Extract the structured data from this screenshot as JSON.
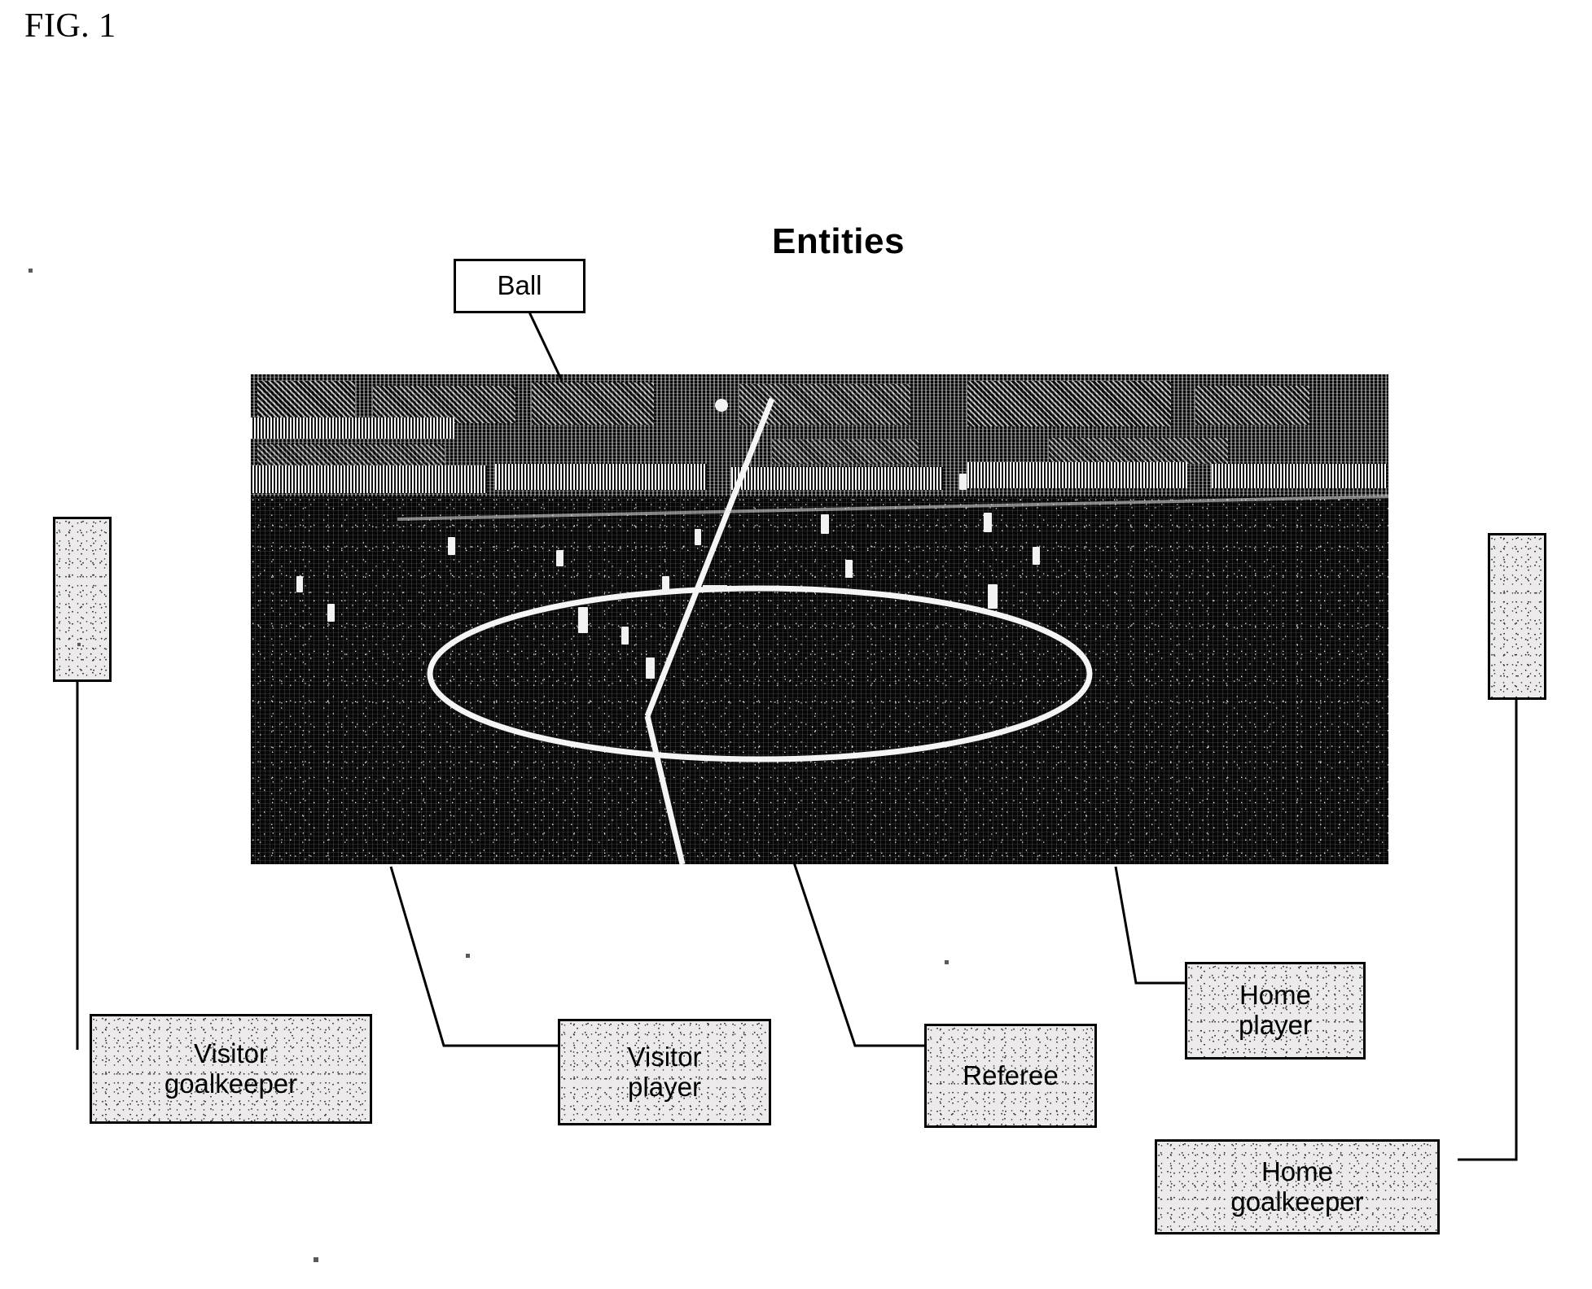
{
  "figure": {
    "number": "FIG. 1",
    "title": "Entities"
  },
  "callouts": {
    "ball": "Ball",
    "visitor_goalkeeper": "Visitor\ngoalkeeper",
    "visitor_player": "Visitor\nplayer",
    "referee": "Referee",
    "home_player": "Home\nplayer",
    "home_goalkeeper": "Home\ngoalkeeper",
    "left_blank": "",
    "right_blank": ""
  },
  "scene": {
    "description": "Black and white photograph of a soccer match viewed from an elevated camera, showing the centre circle, the halfway line, players of both teams, the referee and the crowd with advertising hoardings behind the pitch."
  },
  "colors": {
    "ink": "#000000",
    "page": "#ffffff",
    "callout_fill": "#eceaea",
    "pitch": "#070707",
    "line_marking": "#f5f5f5"
  }
}
